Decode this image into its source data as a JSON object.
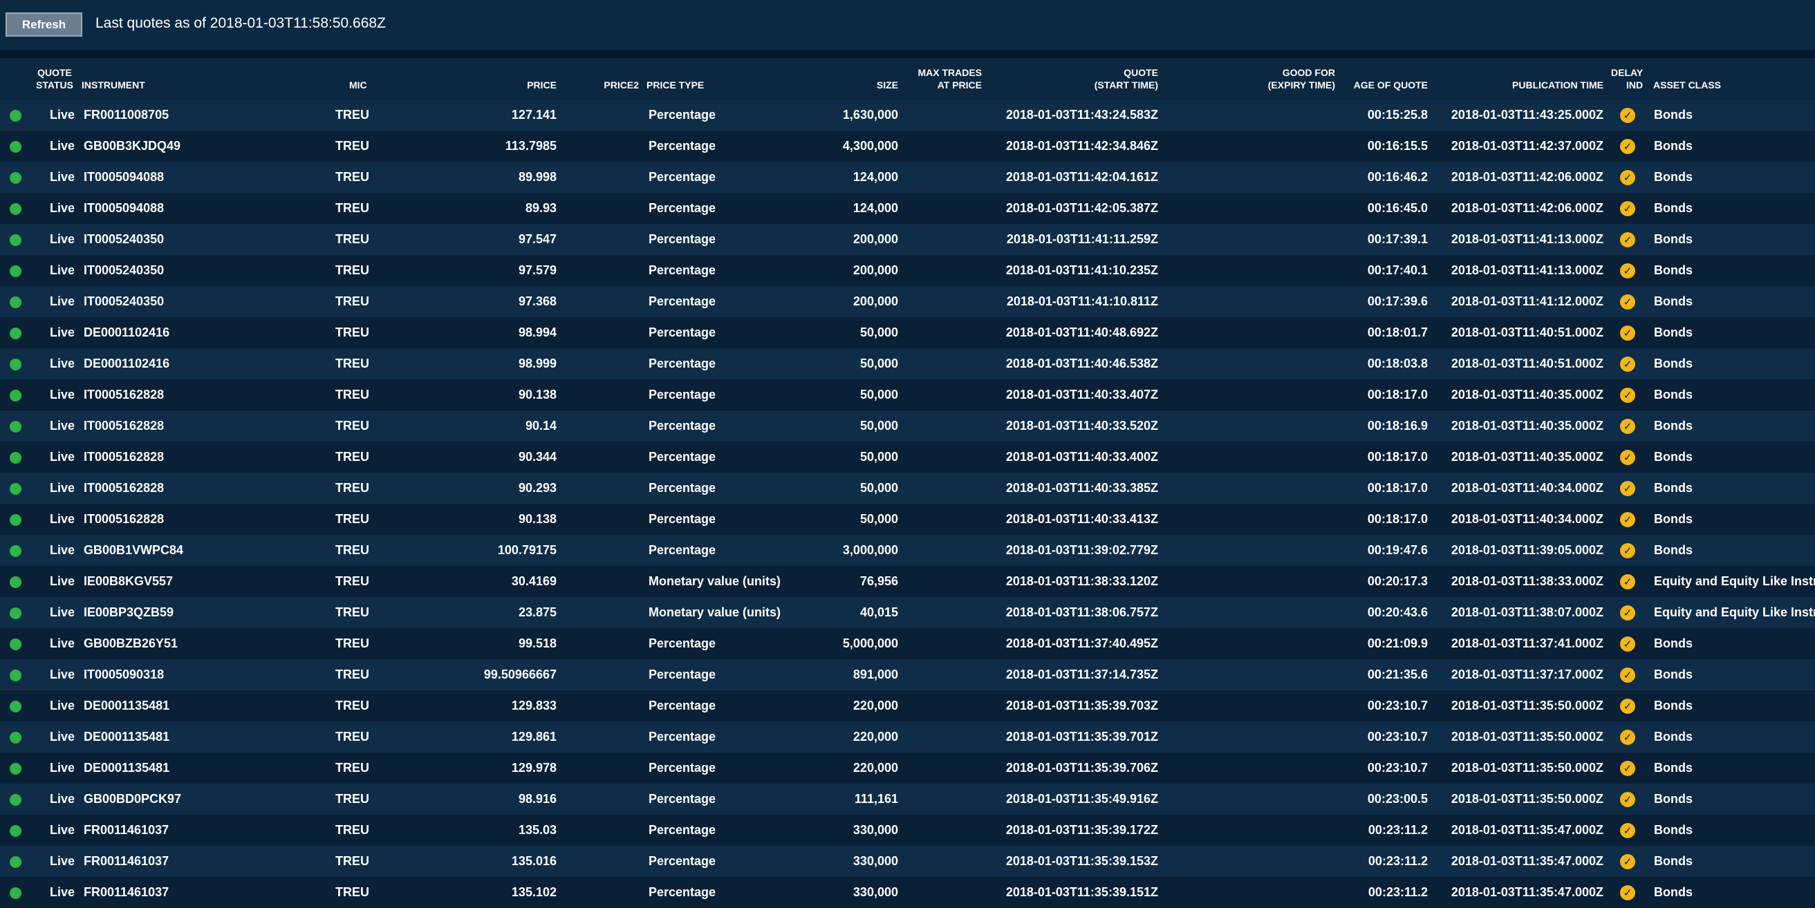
{
  "toolbar": {
    "refresh_label": "Refresh",
    "last_quotes_text": "Last quotes as of 2018-01-03T11:58:50.668Z"
  },
  "columns": {
    "quote_status": [
      "QUOTE",
      "STATUS"
    ],
    "instrument": "INSTRUMENT",
    "mic": "MIC",
    "price": "PRICE",
    "price2": "PRICE2",
    "price_type": "PRICE TYPE",
    "size": "SIZE",
    "max_trades": [
      "MAX TRADES",
      "AT PRICE"
    ],
    "quote_start": [
      "QUOTE",
      "(START TIME)"
    ],
    "good_for": [
      "GOOD FOR",
      "(EXPIRY TIME)"
    ],
    "age": "AGE OF QUOTE",
    "publication": "PUBLICATION TIME",
    "delay_ind": [
      "DELAY",
      "IND"
    ],
    "asset_class": "ASSET CLASS"
  },
  "colors": {
    "live_dot": "#2fb447",
    "delay_icon": "#f2b619"
  },
  "icons": {
    "status": "live-status-dot-icon",
    "delay": "checkmark-circle-icon"
  },
  "rows": [
    {
      "status": "Live",
      "instrument": "FR0011008705",
      "mic": "TREU",
      "price": "127.141",
      "price2": "",
      "price_type": "Percentage",
      "size": "1,630,000",
      "max_trades": "",
      "quote_start": "2018-01-03T11:43:24.583Z",
      "good_for": "",
      "age": "00:15:25.8",
      "publication": "2018-01-03T11:43:25.000Z",
      "asset_class": "Bonds"
    },
    {
      "status": "Live",
      "instrument": "GB00B3KJDQ49",
      "mic": "TREU",
      "price": "113.7985",
      "price2": "",
      "price_type": "Percentage",
      "size": "4,300,000",
      "max_trades": "",
      "quote_start": "2018-01-03T11:42:34.846Z",
      "good_for": "",
      "age": "00:16:15.5",
      "publication": "2018-01-03T11:42:37.000Z",
      "asset_class": "Bonds"
    },
    {
      "status": "Live",
      "instrument": "IT0005094088",
      "mic": "TREU",
      "price": "89.998",
      "price2": "",
      "price_type": "Percentage",
      "size": "124,000",
      "max_trades": "",
      "quote_start": "2018-01-03T11:42:04.161Z",
      "good_for": "",
      "age": "00:16:46.2",
      "publication": "2018-01-03T11:42:06.000Z",
      "asset_class": "Bonds"
    },
    {
      "status": "Live",
      "instrument": "IT0005094088",
      "mic": "TREU",
      "price": "89.93",
      "price2": "",
      "price_type": "Percentage",
      "size": "124,000",
      "max_trades": "",
      "quote_start": "2018-01-03T11:42:05.387Z",
      "good_for": "",
      "age": "00:16:45.0",
      "publication": "2018-01-03T11:42:06.000Z",
      "asset_class": "Bonds"
    },
    {
      "status": "Live",
      "instrument": "IT0005240350",
      "mic": "TREU",
      "price": "97.547",
      "price2": "",
      "price_type": "Percentage",
      "size": "200,000",
      "max_trades": "",
      "quote_start": "2018-01-03T11:41:11.259Z",
      "good_for": "",
      "age": "00:17:39.1",
      "publication": "2018-01-03T11:41:13.000Z",
      "asset_class": "Bonds"
    },
    {
      "status": "Live",
      "instrument": "IT0005240350",
      "mic": "TREU",
      "price": "97.579",
      "price2": "",
      "price_type": "Percentage",
      "size": "200,000",
      "max_trades": "",
      "quote_start": "2018-01-03T11:41:10.235Z",
      "good_for": "",
      "age": "00:17:40.1",
      "publication": "2018-01-03T11:41:13.000Z",
      "asset_class": "Bonds"
    },
    {
      "status": "Live",
      "instrument": "IT0005240350",
      "mic": "TREU",
      "price": "97.368",
      "price2": "",
      "price_type": "Percentage",
      "size": "200,000",
      "max_trades": "",
      "quote_start": "2018-01-03T11:41:10.811Z",
      "good_for": "",
      "age": "00:17:39.6",
      "publication": "2018-01-03T11:41:12.000Z",
      "asset_class": "Bonds"
    },
    {
      "status": "Live",
      "instrument": "DE0001102416",
      "mic": "TREU",
      "price": "98.994",
      "price2": "",
      "price_type": "Percentage",
      "size": "50,000",
      "max_trades": "",
      "quote_start": "2018-01-03T11:40:48.692Z",
      "good_for": "",
      "age": "00:18:01.7",
      "publication": "2018-01-03T11:40:51.000Z",
      "asset_class": "Bonds"
    },
    {
      "status": "Live",
      "instrument": "DE0001102416",
      "mic": "TREU",
      "price": "98.999",
      "price2": "",
      "price_type": "Percentage",
      "size": "50,000",
      "max_trades": "",
      "quote_start": "2018-01-03T11:40:46.538Z",
      "good_for": "",
      "age": "00:18:03.8",
      "publication": "2018-01-03T11:40:51.000Z",
      "asset_class": "Bonds"
    },
    {
      "status": "Live",
      "instrument": "IT0005162828",
      "mic": "TREU",
      "price": "90.138",
      "price2": "",
      "price_type": "Percentage",
      "size": "50,000",
      "max_trades": "",
      "quote_start": "2018-01-03T11:40:33.407Z",
      "good_for": "",
      "age": "00:18:17.0",
      "publication": "2018-01-03T11:40:35.000Z",
      "asset_class": "Bonds"
    },
    {
      "status": "Live",
      "instrument": "IT0005162828",
      "mic": "TREU",
      "price": "90.14",
      "price2": "",
      "price_type": "Percentage",
      "size": "50,000",
      "max_trades": "",
      "quote_start": "2018-01-03T11:40:33.520Z",
      "good_for": "",
      "age": "00:18:16.9",
      "publication": "2018-01-03T11:40:35.000Z",
      "asset_class": "Bonds"
    },
    {
      "status": "Live",
      "instrument": "IT0005162828",
      "mic": "TREU",
      "price": "90.344",
      "price2": "",
      "price_type": "Percentage",
      "size": "50,000",
      "max_trades": "",
      "quote_start": "2018-01-03T11:40:33.400Z",
      "good_for": "",
      "age": "00:18:17.0",
      "publication": "2018-01-03T11:40:35.000Z",
      "asset_class": "Bonds"
    },
    {
      "status": "Live",
      "instrument": "IT0005162828",
      "mic": "TREU",
      "price": "90.293",
      "price2": "",
      "price_type": "Percentage",
      "size": "50,000",
      "max_trades": "",
      "quote_start": "2018-01-03T11:40:33.385Z",
      "good_for": "",
      "age": "00:18:17.0",
      "publication": "2018-01-03T11:40:34.000Z",
      "asset_class": "Bonds"
    },
    {
      "status": "Live",
      "instrument": "IT0005162828",
      "mic": "TREU",
      "price": "90.138",
      "price2": "",
      "price_type": "Percentage",
      "size": "50,000",
      "max_trades": "",
      "quote_start": "2018-01-03T11:40:33.413Z",
      "good_for": "",
      "age": "00:18:17.0",
      "publication": "2018-01-03T11:40:34.000Z",
      "asset_class": "Bonds"
    },
    {
      "status": "Live",
      "instrument": "GB00B1VWPC84",
      "mic": "TREU",
      "price": "100.79175",
      "price2": "",
      "price_type": "Percentage",
      "size": "3,000,000",
      "max_trades": "",
      "quote_start": "2018-01-03T11:39:02.779Z",
      "good_for": "",
      "age": "00:19:47.6",
      "publication": "2018-01-03T11:39:05.000Z",
      "asset_class": "Bonds"
    },
    {
      "status": "Live",
      "instrument": "IE00B8KGV557",
      "mic": "TREU",
      "price": "30.4169",
      "price2": "",
      "price_type": "Monetary value (units)",
      "size": "76,956",
      "max_trades": "",
      "quote_start": "2018-01-03T11:38:33.120Z",
      "good_for": "",
      "age": "00:20:17.3",
      "publication": "2018-01-03T11:38:33.000Z",
      "asset_class": "Equity and Equity Like Instru"
    },
    {
      "status": "Live",
      "instrument": "IE00BP3QZB59",
      "mic": "TREU",
      "price": "23.875",
      "price2": "",
      "price_type": "Monetary value (units)",
      "size": "40,015",
      "max_trades": "",
      "quote_start": "2018-01-03T11:38:06.757Z",
      "good_for": "",
      "age": "00:20:43.6",
      "publication": "2018-01-03T11:38:07.000Z",
      "asset_class": "Equity and Equity Like Instru"
    },
    {
      "status": "Live",
      "instrument": "GB00BZB26Y51",
      "mic": "TREU",
      "price": "99.518",
      "price2": "",
      "price_type": "Percentage",
      "size": "5,000,000",
      "max_trades": "",
      "quote_start": "2018-01-03T11:37:40.495Z",
      "good_for": "",
      "age": "00:21:09.9",
      "publication": "2018-01-03T11:37:41.000Z",
      "asset_class": "Bonds"
    },
    {
      "status": "Live",
      "instrument": "IT0005090318",
      "mic": "TREU",
      "price": "99.50966667",
      "price2": "",
      "price_type": "Percentage",
      "size": "891,000",
      "max_trades": "",
      "quote_start": "2018-01-03T11:37:14.735Z",
      "good_for": "",
      "age": "00:21:35.6",
      "publication": "2018-01-03T11:37:17.000Z",
      "asset_class": "Bonds"
    },
    {
      "status": "Live",
      "instrument": "DE0001135481",
      "mic": "TREU",
      "price": "129.833",
      "price2": "",
      "price_type": "Percentage",
      "size": "220,000",
      "max_trades": "",
      "quote_start": "2018-01-03T11:35:39.703Z",
      "good_for": "",
      "age": "00:23:10.7",
      "publication": "2018-01-03T11:35:50.000Z",
      "asset_class": "Bonds"
    },
    {
      "status": "Live",
      "instrument": "DE0001135481",
      "mic": "TREU",
      "price": "129.861",
      "price2": "",
      "price_type": "Percentage",
      "size": "220,000",
      "max_trades": "",
      "quote_start": "2018-01-03T11:35:39.701Z",
      "good_for": "",
      "age": "00:23:10.7",
      "publication": "2018-01-03T11:35:50.000Z",
      "asset_class": "Bonds"
    },
    {
      "status": "Live",
      "instrument": "DE0001135481",
      "mic": "TREU",
      "price": "129.978",
      "price2": "",
      "price_type": "Percentage",
      "size": "220,000",
      "max_trades": "",
      "quote_start": "2018-01-03T11:35:39.706Z",
      "good_for": "",
      "age": "00:23:10.7",
      "publication": "2018-01-03T11:35:50.000Z",
      "asset_class": "Bonds"
    },
    {
      "status": "Live",
      "instrument": "GB00BD0PCK97",
      "mic": "TREU",
      "price": "98.916",
      "price2": "",
      "price_type": "Percentage",
      "size": "111,161",
      "max_trades": "",
      "quote_start": "2018-01-03T11:35:49.916Z",
      "good_for": "",
      "age": "00:23:00.5",
      "publication": "2018-01-03T11:35:50.000Z",
      "asset_class": "Bonds"
    },
    {
      "status": "Live",
      "instrument": "FR0011461037",
      "mic": "TREU",
      "price": "135.03",
      "price2": "",
      "price_type": "Percentage",
      "size": "330,000",
      "max_trades": "",
      "quote_start": "2018-01-03T11:35:39.172Z",
      "good_for": "",
      "age": "00:23:11.2",
      "publication": "2018-01-03T11:35:47.000Z",
      "asset_class": "Bonds"
    },
    {
      "status": "Live",
      "instrument": "FR0011461037",
      "mic": "TREU",
      "price": "135.016",
      "price2": "",
      "price_type": "Percentage",
      "size": "330,000",
      "max_trades": "",
      "quote_start": "2018-01-03T11:35:39.153Z",
      "good_for": "",
      "age": "00:23:11.2",
      "publication": "2018-01-03T11:35:47.000Z",
      "asset_class": "Bonds"
    },
    {
      "status": "Live",
      "instrument": "FR0011461037",
      "mic": "TREU",
      "price": "135.102",
      "price2": "",
      "price_type": "Percentage",
      "size": "330,000",
      "max_trades": "",
      "quote_start": "2018-01-03T11:35:39.151Z",
      "good_for": "",
      "age": "00:23:11.2",
      "publication": "2018-01-03T11:35:47.000Z",
      "asset_class": "Bonds"
    }
  ]
}
